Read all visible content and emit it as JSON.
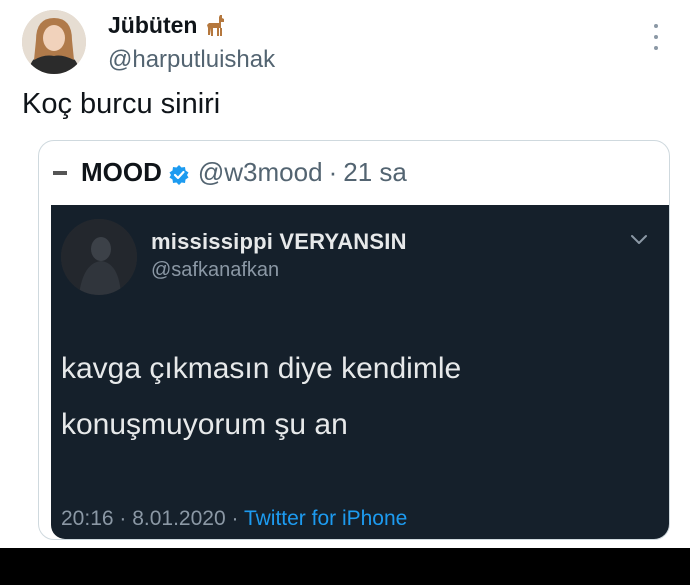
{
  "tweet": {
    "author_name": "Jübüten",
    "author_handle": "@harputluishak",
    "text": "Koç burcu siniri",
    "more_icon": "more-vertical-icon",
    "author_emoji_icon": "llama-icon"
  },
  "quoted_tweet": {
    "name": "MOOD",
    "handle": "@w3mood",
    "separator": "·",
    "time": "21 sa",
    "verified_icon": "verified-badge-icon"
  },
  "screenshot": {
    "name": "mississippi VERYANSIN",
    "handle": "@safkanafkan",
    "text_line1": "kavga çıkmasın diye kendimle",
    "text_line2": "konuşmuyorum şu an",
    "timestamp": "20:16 · 8.01.2020 ·",
    "source": "Twitter for iPhone",
    "chevron_icon": "chevron-down-icon"
  },
  "colors": {
    "primary_text": "#0f1419",
    "secondary_text": "#536471",
    "dark_bg": "#15202b",
    "link_blue": "#1d9bf0"
  }
}
